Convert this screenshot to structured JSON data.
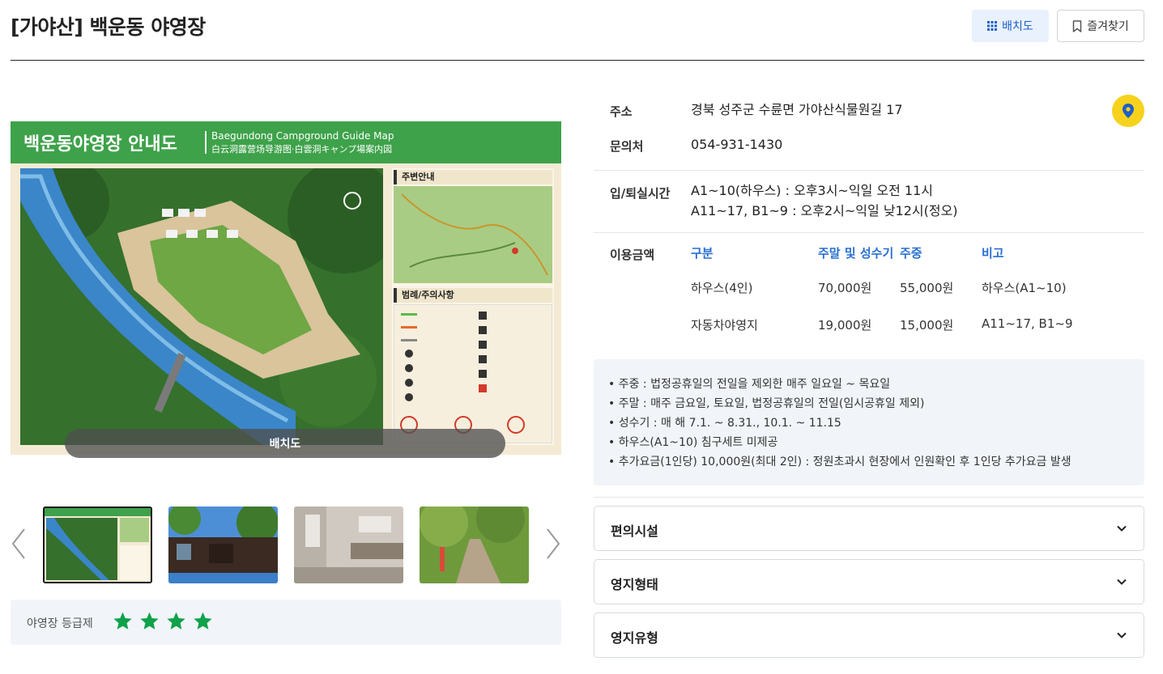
{
  "header": {
    "title": "[가야산] 백운동 야영장",
    "layout_button": "배치도",
    "favorite_button": "즐겨찾기"
  },
  "map": {
    "title_ko": "백운동야영장 안내도",
    "title_en": "Baegundong Campground Guide Map",
    "title_cjk": "白云洞露营场导游图·白雲洞キャンプ場案内図",
    "section_neighborhood": "주변안내",
    "section_legend": "범례/주의사항",
    "caption": "배치도"
  },
  "thumbnails": [
    "map",
    "cabin",
    "washroom",
    "trail"
  ],
  "grade": {
    "label": "야영장 등급제",
    "stars": 4,
    "star_color": "#0ea24a"
  },
  "info": {
    "address_label": "주소",
    "address": "경북 성주군 수륜면 가야산식물원길 17",
    "phone_label": "문의처",
    "phone": "054-931-1430",
    "checkin_label": "입/퇴실시간",
    "checkin_line1": "A1~10(하우스) : 오후3시~익일 오전 11시",
    "checkin_line2": "A11~17, B1~9 : 오후2시~익일 낮12시(정오)",
    "price_label": "이용금액"
  },
  "price_table": {
    "headers": [
      "구분",
      "주말 및 성수기",
      "주중",
      "비고"
    ],
    "rows": [
      [
        "하우스(4인)",
        "70,000원",
        "55,000원",
        "하우스(A1~10)"
      ],
      [
        "자동차야영지",
        "19,000원",
        "15,000원",
        "A11~17, B1~9"
      ]
    ]
  },
  "notes": [
    "주중 : 법정공휴일의 전일을 제외한 매주 일요일 ~ 목요일",
    "주말 : 매주 금요일, 토요일, 법정공휴일의 전일(임시공휴일 제외)",
    "성수기 : 매 해 7.1. ~ 8.31., 10.1. ~ 11.15",
    "하우스(A1~10) 침구세트 미제공",
    "추가요금(1인당) 10,000원(최대 2인) : 정원초과시 현장에서 인원확인 후 1인당 추가요금 발생"
  ],
  "accordions": [
    "편의시설",
    "영지형태",
    "영지유형"
  ],
  "colors": {
    "accent_blue": "#2a6fd0",
    "map_green": "#3ea24a",
    "location_yellow": "#f6d21c"
  }
}
